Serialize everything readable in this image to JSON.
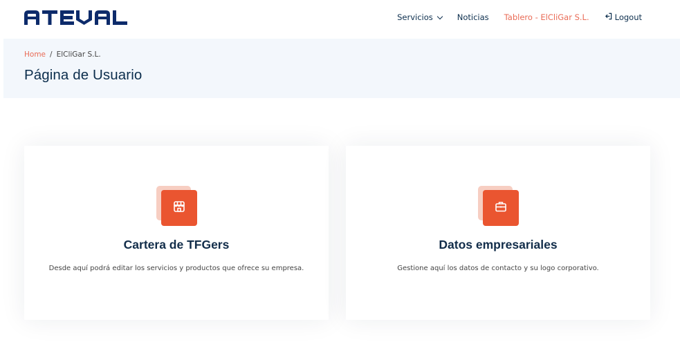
{
  "brand": {
    "name": "ATEVAL",
    "color": "#0d2b6b"
  },
  "colors": {
    "accent": "#e96b56",
    "icon_bg": "#ea5530",
    "icon_back": "#f7cec2",
    "band": "#f3f7fc"
  },
  "nav": {
    "items": [
      {
        "label": "Servicios",
        "has_dropdown": true
      },
      {
        "label": "Noticias"
      },
      {
        "label": "Tablero - ElCliGar S.L.",
        "active": true
      },
      {
        "label": "Logout",
        "icon": "logout-icon"
      }
    ]
  },
  "breadcrumb": {
    "home": "Home",
    "separator": "/",
    "current": "ElCliGar S.L."
  },
  "page": {
    "title": "Página de Usuario"
  },
  "cards": [
    {
      "title": "Cartera de TFGers",
      "description": "Desde aquí podrá editar los servicios y productos que ofrece su empresa.",
      "icon": "store-icon"
    },
    {
      "title": "Datos empresariales",
      "description": "Gestione aquí los datos de contacto y su logo corporativo.",
      "icon": "briefcase-icon"
    }
  ]
}
